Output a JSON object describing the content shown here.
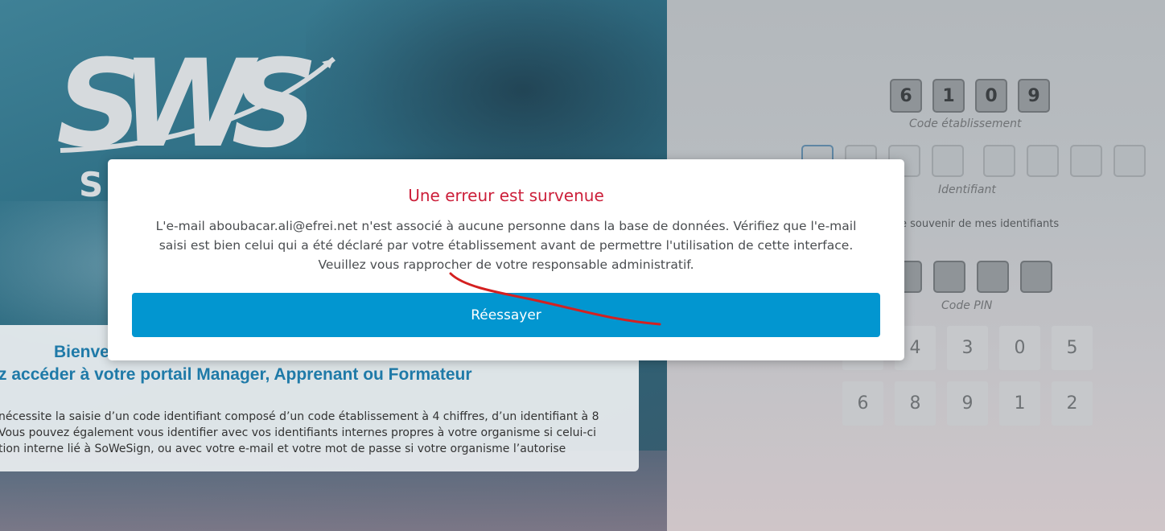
{
  "logo": {
    "text": "SWS",
    "subtext": "S"
  },
  "welcome": {
    "title_line1": "Bienve",
    "title_line2": "z accéder à votre portail Manager, Apprenant ou Formateur",
    "body_line1": "nécessite la saisie d’un code identifiant composé d’un code établissement à 4 chiffres, d’un identifiant à 8",
    "body_line2": "Vous pouvez également vous identifier avec vos identifiants internes propres à votre organisme si celui-ci",
    "body_line3": "tion interne lié à SoWeSign, ou avec votre e-mail et votre mot de passe si votre organisme l’autorise"
  },
  "login": {
    "code_digits": [
      "6",
      "1",
      "0",
      "9"
    ],
    "code_label": "Code établissement",
    "identifier_label": "Identifiant",
    "remember_label": "e souvenir de mes identifiants",
    "pin_label": "Code PIN",
    "keypad_row1": [
      "4",
      "3",
      "0",
      "5"
    ],
    "keypad_row2": [
      "6",
      "8",
      "9",
      "1",
      "2"
    ]
  },
  "modal": {
    "title": "Une erreur est survenue",
    "message_line1": "L'e-mail aboubacar.ali@efrei.net n'est associé à aucune personne dans la base de données. Vérifiez que l'e-mail",
    "message_line2": "saisi est bien celui qui a été déclaré par votre établissement avant de permettre l'utilisation de cette interface.",
    "message_line3": "Veuillez vous rapprocher de votre responsable administratif.",
    "retry_label": "Réessayer"
  },
  "colors": {
    "accent": "#0296d0",
    "error": "#cc1f3a",
    "welcome_title": "#1f7aa8",
    "annotation": "#d42020"
  }
}
